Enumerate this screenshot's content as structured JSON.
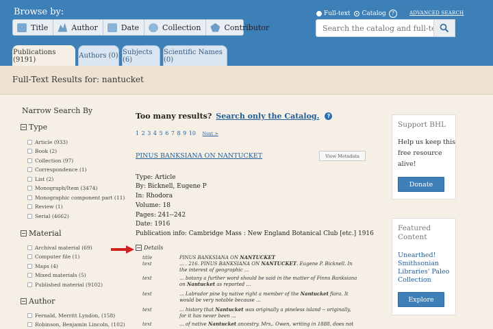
{
  "header": {
    "browse_label": "Browse by:",
    "browse_buttons": [
      {
        "label": "Title",
        "icon": "book-icon"
      },
      {
        "label": "Author",
        "icon": "author-icon"
      },
      {
        "label": "Date",
        "icon": "calendar-icon"
      },
      {
        "label": "Collection",
        "icon": "collection-icon"
      },
      {
        "label": "Contributor",
        "icon": "building-icon"
      }
    ],
    "search_modes": {
      "fulltext": "Full-text",
      "catalog": "Catalog",
      "selected": "Catalog"
    },
    "help": "?",
    "advanced_search": "ADVANCED SEARCH",
    "search_placeholder": "Search the catalog and full-text"
  },
  "tabs": [
    {
      "label": "Publications (9191)",
      "active": true
    },
    {
      "label": "Authors (0)",
      "active": false
    },
    {
      "label": "Subjects (6)",
      "active": false
    },
    {
      "label": "Scientific Names (0)",
      "active": false
    }
  ],
  "results_title": "Full-Text Results for: nantucket",
  "sidebar": {
    "title": "Narrow Search By",
    "type_head": "Type",
    "types": [
      "Article (933)",
      "Book (2)",
      "Collection (97)",
      "Correspondence (1)",
      "List (2)",
      "Monograph/Item (3474)",
      "Monographic component part (11)",
      "Review (1)",
      "Serial (4662)"
    ],
    "material_head": "Material",
    "materials": [
      "Archival material (69)",
      "Computer file (1)",
      "Maps (4)",
      "Mixed materials (5)",
      "Published material (9102)"
    ],
    "author_head": "Author",
    "authors": [
      "Fernald, Merritt Lyndon, (158)",
      "Robinson, Benjamin Lincoln, (102)"
    ]
  },
  "main": {
    "too_many": "Too many results?",
    "catalog_link": "Search only the Catalog.",
    "pages": [
      "1",
      "2",
      "3",
      "4",
      "5",
      "6",
      "7",
      "8",
      "9",
      "10"
    ],
    "next": "Next >",
    "result_title": "PINUS BANKSIANA ON NANTUCKET",
    "view_metadata": "View Metadata",
    "type": "Type: Article",
    "by": "By: Bicknell, Eugene P",
    "in": "In: Rhodora",
    "volume": "Volume: 18",
    "pages_line": "Pages: 241--242",
    "date": "Date: 1916",
    "pub_info": "Publication info: Cambridge Mass : New England Botanical Club [etc.] 1916",
    "details": "Details",
    "detail_rows": [
      {
        "label": "title",
        "html": "PINUS BANKSIANA ON <b>NANTUCKET</b>"
      },
      {
        "label": "text",
        "html": "... . 216. PINUS BANKSIANA ON <b>NANTUCKET</b>. Eugene P. Bicknell. In the interest of geographic ..."
      },
      {
        "label": "text",
        "html": "... botany a further word should be said in the matter of Finns Banksiana on <b>Nantucket</b> as reported ..."
      },
      {
        "label": "text",
        "html": "... Labrador pine by native right a member of the <b>Nantucket</b> flora. It would be very notable because ..."
      },
      {
        "label": "text",
        "html": "... history that <b>Nantucket</b> was originally a pineless island -- originally, for it has never been ..."
      },
      {
        "label": "text",
        "html": "... of native <b>Nantucket</b> ancestry. Mrs,. Owen, writing in 1888, does not"
      }
    ]
  },
  "support": {
    "title": "Support BHL",
    "text1": "Help us keep this",
    "text2": "free resource",
    "text3": "alive!",
    "donate": "Donate"
  },
  "featured": {
    "title1": "Featured",
    "title2": "Content",
    "link1": "Unearthed!",
    "link2": "Smithsonian",
    "link3": "Libraries' Paleo",
    "link4": "Collection",
    "explore": "Explore"
  }
}
